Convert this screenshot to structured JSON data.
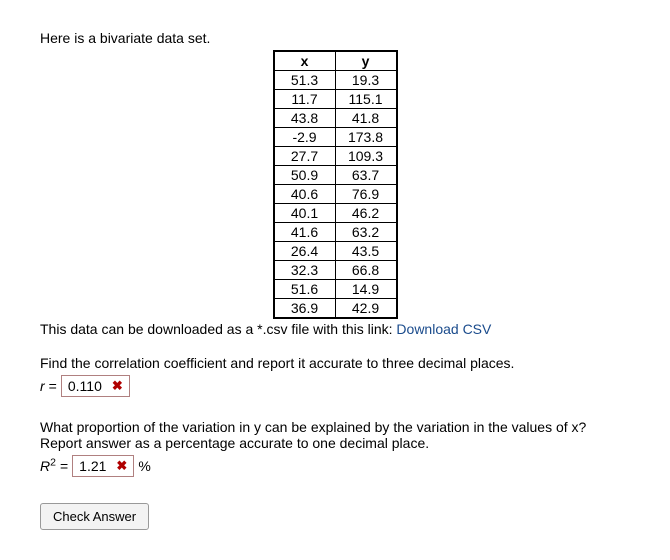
{
  "intro": "Here is a bivariate data set.",
  "table": {
    "headers": {
      "x": "x",
      "y": "y"
    },
    "rows": [
      {
        "x": "51.3",
        "y": "19.3"
      },
      {
        "x": "11.7",
        "y": "115.1"
      },
      {
        "x": "43.8",
        "y": "41.8"
      },
      {
        "x": "-2.9",
        "y": "173.8"
      },
      {
        "x": "27.7",
        "y": "109.3"
      },
      {
        "x": "50.9",
        "y": "63.7"
      },
      {
        "x": "40.6",
        "y": "76.9"
      },
      {
        "x": "40.1",
        "y": "46.2"
      },
      {
        "x": "41.6",
        "y": "63.2"
      },
      {
        "x": "26.4",
        "y": "43.5"
      },
      {
        "x": "32.3",
        "y": "66.8"
      },
      {
        "x": "51.6",
        "y": "14.9"
      },
      {
        "x": "36.9",
        "y": "42.9"
      }
    ]
  },
  "download": {
    "text": "This data can be downloaded as a *.csv file with this link: ",
    "link_label": "Download CSV"
  },
  "q1": {
    "text": "Find the correlation coefficient and report it accurate to three decimal places.",
    "label_var": "r",
    "eq": " = ",
    "value": "0.110",
    "status": "incorrect"
  },
  "q2": {
    "text": "What proportion of the variation in y can be explained by the variation in the values of x? Report answer as a percentage accurate to one decimal place.",
    "label_var": "R",
    "label_sup": "2",
    "eq": " = ",
    "value": "1.21",
    "unit": "%",
    "status": "incorrect"
  },
  "button": {
    "check": "Check Answer"
  }
}
